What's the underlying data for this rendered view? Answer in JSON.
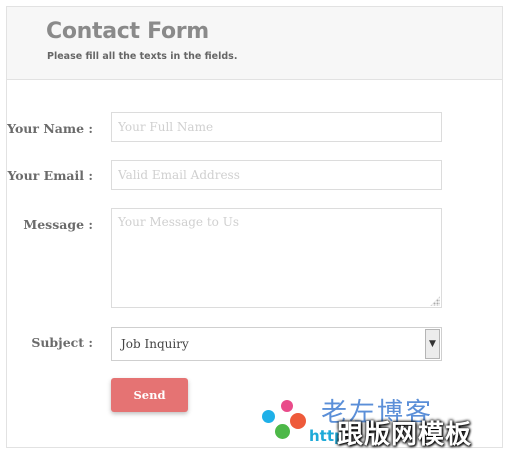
{
  "header": {
    "title": "Contact Form",
    "subtitle": "Please fill all the texts in the fields."
  },
  "form": {
    "name": {
      "label": "Your Name :",
      "placeholder": "Your Full Name",
      "value": ""
    },
    "email": {
      "label": "Your Email :",
      "placeholder": "Valid Email Address",
      "value": ""
    },
    "message": {
      "label": "Message :",
      "placeholder": "Your Message to Us",
      "value": ""
    },
    "subject": {
      "label": "Subject :",
      "selected": "Job Inquiry"
    },
    "send_label": "Send"
  },
  "watermark": {
    "cn_top": "老左博客",
    "url": "http",
    "cn_bottom": "跟版网模板"
  },
  "colors": {
    "accent": "#e57373",
    "header_bg": "#f7f7f7",
    "label_text": "#6b6b6b"
  }
}
